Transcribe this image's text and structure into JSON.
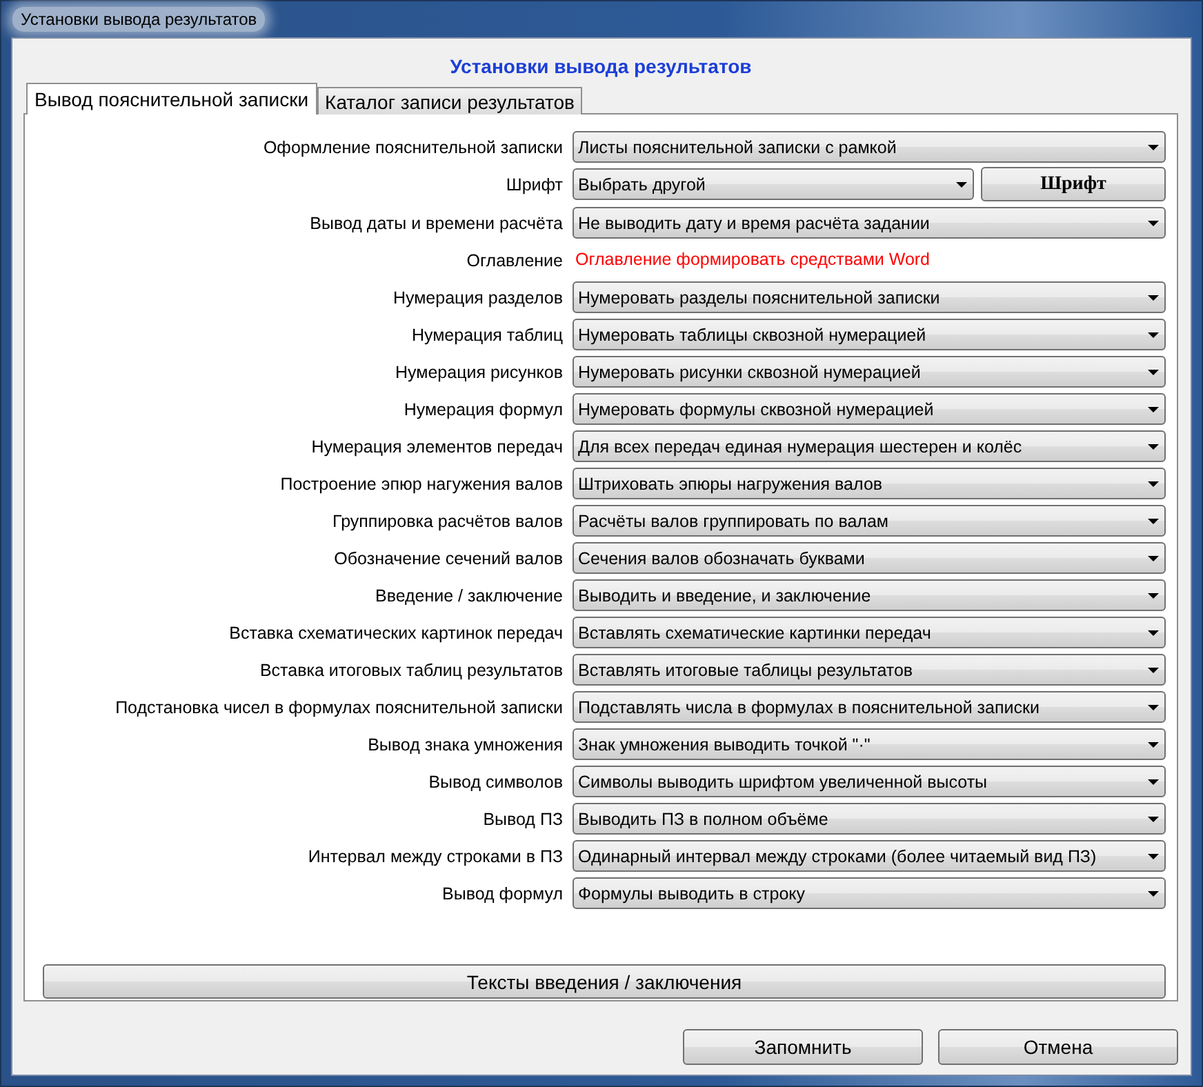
{
  "window": {
    "title": "Установки вывода результатов"
  },
  "heading": "Установки вывода результатов",
  "tabs": [
    {
      "label": "Вывод пояснительной записки",
      "selected": true
    },
    {
      "label": "Каталог записи результатов",
      "selected": false
    }
  ],
  "settings": [
    {
      "kind": "select",
      "label": "Оформление пояснительной записки",
      "value": "Листы пояснительной записки с рамкой"
    },
    {
      "kind": "select_button",
      "label": "Шрифт",
      "value": "Выбрать другой",
      "button": "Шрифт"
    },
    {
      "kind": "select",
      "label": "Вывод даты и времени расчёта",
      "value": "Не выводить дату и время расчёта задании"
    },
    {
      "kind": "note",
      "label": "Оглавление",
      "value": "Оглавление формировать средствами Word"
    },
    {
      "kind": "select",
      "label": "Нумерация разделов",
      "value": "Нумеровать разделы пояснительной записки"
    },
    {
      "kind": "select",
      "label": "Нумерация таблиц",
      "value": "Нумеровать таблицы сквозной нумерацией"
    },
    {
      "kind": "select",
      "label": "Нумерация рисунков",
      "value": "Нумеровать рисунки сквозной нумерацией"
    },
    {
      "kind": "select",
      "label": "Нумерация формул",
      "value": "Нумеровать формулы сквозной нумерацией"
    },
    {
      "kind": "select",
      "label": "Нумерация элементов передач",
      "value": "Для всех передач единая нумерация шестерен и колёс"
    },
    {
      "kind": "select",
      "label": "Построение эпюр нагужения валов",
      "value": "Штриховать эпюры нагружения валов"
    },
    {
      "kind": "select",
      "label": "Группировка расчётов валов",
      "value": "Расчёты валов группировать по валам"
    },
    {
      "kind": "select",
      "label": "Обозначение сечений валов",
      "value": "Сечения валов обозначать буквами"
    },
    {
      "kind": "select",
      "label": "Введение / заключение",
      "value": "Выводить и введение, и заключение"
    },
    {
      "kind": "select",
      "label": "Вставка схематических картинок передач",
      "value": "Вставлять схематические картинки передач"
    },
    {
      "kind": "select",
      "label": "Вставка итоговых таблиц результатов",
      "value": "Вставлять итоговые таблицы результатов"
    },
    {
      "kind": "select",
      "label": "Подстановка чисел в формулах пояснительной записки",
      "value": "Подставлять числа в формулах в пояснительной записки"
    },
    {
      "kind": "select",
      "label": "Вывод знака умножения",
      "value": "Знак умножения выводить точкой \"·\""
    },
    {
      "kind": "select",
      "label": "Вывод символов",
      "value": "Символы выводить шрифтом увеличенной высоты"
    },
    {
      "kind": "select",
      "label": "Вывод ПЗ",
      "value": "Выводить ПЗ в полном объёме"
    },
    {
      "kind": "select",
      "label": "Интервал между строками в ПЗ",
      "value": "Одинарный интервал между строками (более читаемый вид ПЗ)"
    },
    {
      "kind": "select",
      "label": "Вывод формул",
      "value": "Формулы выводить в строку"
    }
  ],
  "texts_button": "Тексты введения / заключения",
  "buttons": [
    "Запомнить",
    "Отмена"
  ]
}
